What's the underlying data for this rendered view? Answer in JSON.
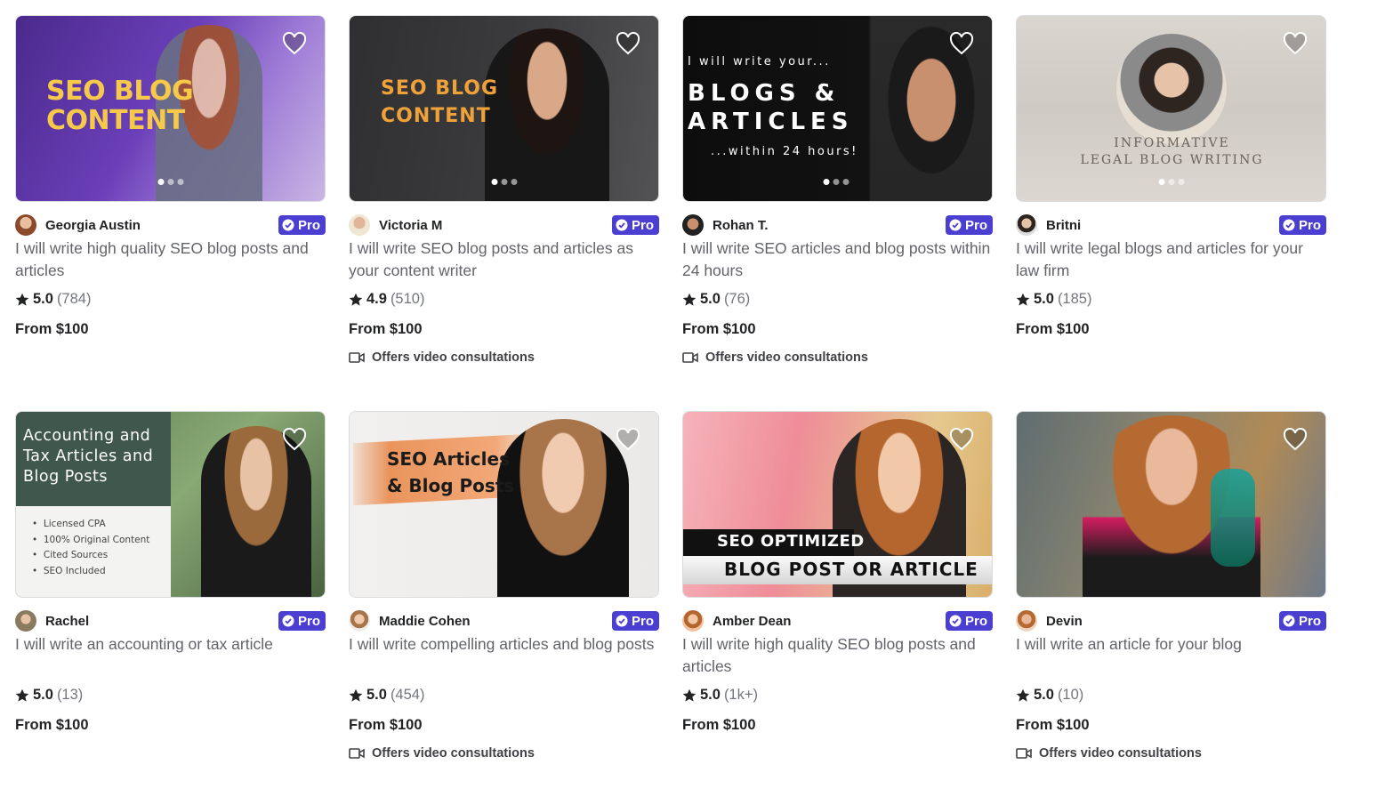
{
  "colors": {
    "pro_badge": "#4b3fd2",
    "text_dark": "#222325",
    "text_muted": "#62646a"
  },
  "cards": [
    {
      "seller": "Georgia Austin",
      "pro": "Pro",
      "title": "I will write high quality SEO blog posts and articles",
      "rating": "5.0",
      "reviews": "(784)",
      "price": "From $100",
      "video": "",
      "thumb_text": [
        "SEO BLOG",
        "CONTENT"
      ]
    },
    {
      "seller": "Victoria M",
      "pro": "Pro",
      "title": "I will write SEO blog posts and articles as your content writer",
      "rating": "4.9",
      "reviews": "(510)",
      "price": "From $100",
      "video": "Offers video consultations",
      "thumb_text": [
        "SEO BLOG",
        "CONTENT"
      ]
    },
    {
      "seller": "Rohan T.",
      "pro": "Pro",
      "title": "I will write SEO articles and blog posts within 24 hours",
      "rating": "5.0",
      "reviews": "(76)",
      "price": "From $100",
      "video": "Offers video consultations",
      "thumb_text": [
        "I will write your...",
        "BLOGS &",
        "ARTICLES",
        "...within 24 hours!"
      ]
    },
    {
      "seller": "Britni",
      "pro": "Pro",
      "title": "I will write legal blogs and articles for your law firm",
      "rating": "5.0",
      "reviews": "(185)",
      "price": "From $100",
      "video": "",
      "thumb_text": [
        "INFORMATIVE",
        "LEGAL BLOG WRITING"
      ]
    },
    {
      "seller": "Rachel",
      "pro": "Pro",
      "title": "I will write an accounting or tax article",
      "rating": "5.0",
      "reviews": "(13)",
      "price": "From $100",
      "video": "",
      "thumb_text": [
        "Accounting and",
        "Tax Articles and",
        "Blog Posts",
        "Licensed CPA",
        "100% Original Content",
        "Cited Sources",
        "SEO Included"
      ]
    },
    {
      "seller": "Maddie Cohen",
      "pro": "Pro",
      "title": "I will write compelling articles and blog posts",
      "rating": "5.0",
      "reviews": "(454)",
      "price": "From $100",
      "video": "Offers video consultations",
      "thumb_text": [
        "SEO Articles",
        "& Blog Posts"
      ]
    },
    {
      "seller": "Amber Dean",
      "pro": "Pro",
      "title": "I will write high quality SEO blog posts and articles",
      "rating": "5.0",
      "reviews": "(1k+)",
      "price": "From $100",
      "video": "",
      "thumb_text": [
        "SEO OPTIMIZED",
        "BLOG POST OR ARTICLE"
      ]
    },
    {
      "seller": "Devin",
      "pro": "Pro",
      "title": "I will write an article for your blog",
      "rating": "5.0",
      "reviews": "(10)",
      "price": "From $100",
      "video": "Offers video consultations",
      "thumb_text": []
    }
  ]
}
